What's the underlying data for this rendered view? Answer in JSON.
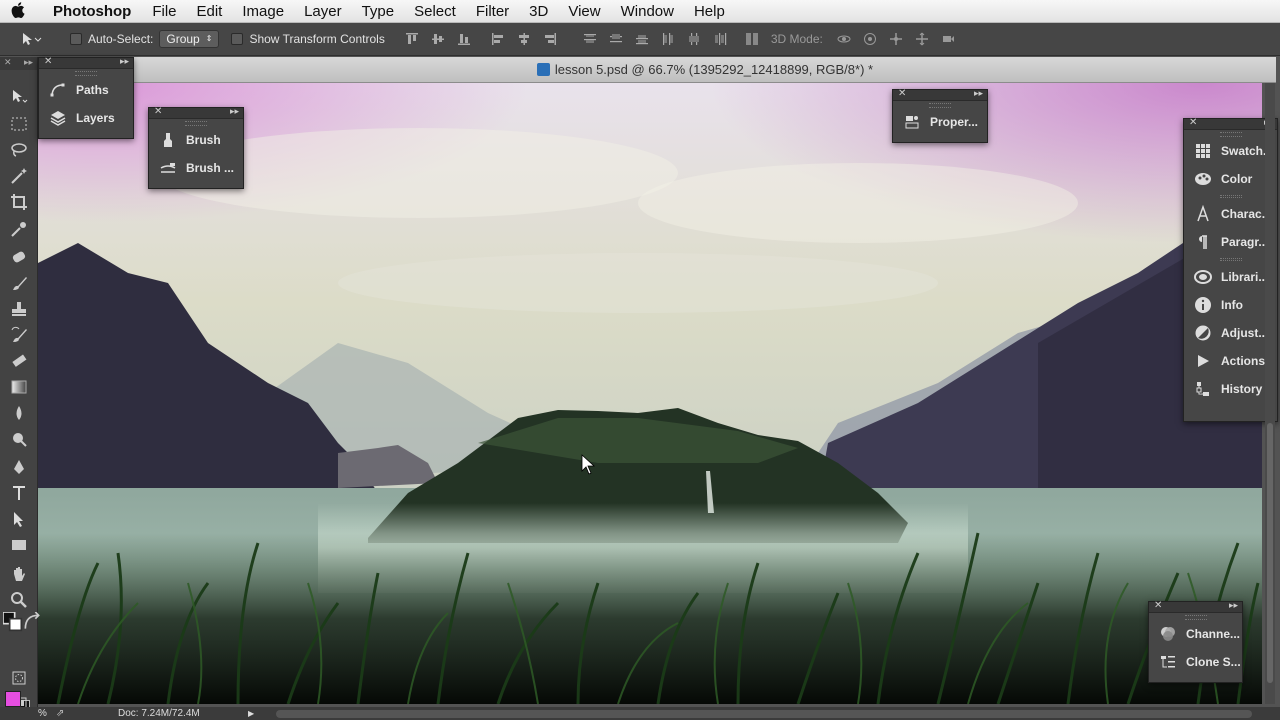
{
  "menubar": {
    "app_name": "Photoshop",
    "items": [
      "File",
      "Edit",
      "Image",
      "Layer",
      "Type",
      "Select",
      "Filter",
      "3D",
      "View",
      "Window",
      "Help"
    ]
  },
  "options_bar": {
    "auto_select_label": "Auto-Select:",
    "auto_select_value": "Group",
    "show_transform_label": "Show Transform Controls",
    "mode_label": "3D Mode:"
  },
  "document": {
    "title": "lesson 5.psd @ 66.7% (1395292_12418899, RGB/8*) *"
  },
  "panels": {
    "paths_layers": [
      {
        "label": "Paths",
        "icon": "paths-icon"
      },
      {
        "label": "Layers",
        "icon": "layers-icon"
      }
    ],
    "brush": [
      {
        "label": "Brush",
        "icon": "brush-icon"
      },
      {
        "label": "Brush ...",
        "icon": "brush-presets-icon"
      }
    ],
    "properties": [
      {
        "label": "Proper...",
        "icon": "properties-icon"
      }
    ],
    "right_group1": [
      {
        "label": "Swatch...",
        "icon": "swatches-icon"
      },
      {
        "label": "Color",
        "icon": "color-icon"
      }
    ],
    "right_group2": [
      {
        "label": "Charac...",
        "icon": "character-icon"
      },
      {
        "label": "Paragr...",
        "icon": "paragraph-icon"
      }
    ],
    "right_group3": [
      {
        "label": "Librari...",
        "icon": "libraries-icon"
      },
      {
        "label": "Info",
        "icon": "info-icon"
      },
      {
        "label": "Adjust...",
        "icon": "adjustments-icon"
      },
      {
        "label": "Actions",
        "icon": "actions-icon"
      },
      {
        "label": "History",
        "icon": "history-icon"
      }
    ],
    "channels": [
      {
        "label": "Channe...",
        "icon": "channels-icon"
      },
      {
        "label": "Clone S...",
        "icon": "clone-source-icon"
      }
    ]
  },
  "status": {
    "zoom": "%",
    "doc_info": "Doc: 7.24M/72.4M"
  },
  "colors": {
    "foreground": "#e64ee0",
    "background": "#111111"
  }
}
